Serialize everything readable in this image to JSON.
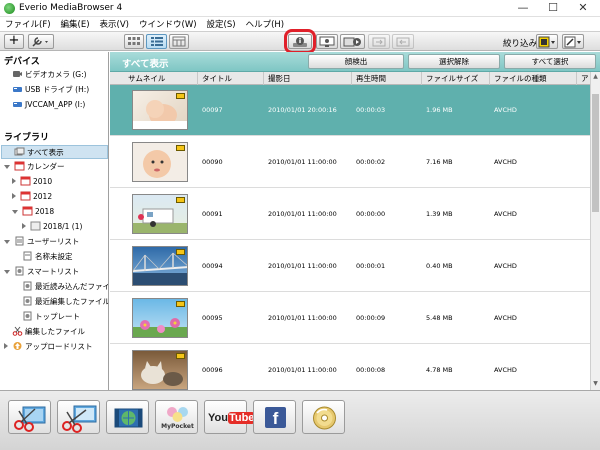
{
  "window": {
    "title": "Everio MediaBrowser 4",
    "minimize": "—",
    "maximize": "☐",
    "close": "✕"
  },
  "menu": [
    "ファイル(F)",
    "編集(E)",
    "表示(V)",
    "ウインドウ(W)",
    "設定(S)",
    "ヘルプ(H)"
  ],
  "toolbar": {
    "add_label": "+",
    "filter_label": "絞り込み"
  },
  "sidebar": {
    "devices_heading": "デバイス",
    "devices": [
      "ビデオカメラ (G:)",
      "USB ドライブ (H:)",
      "JVCCAM_APP (I:)"
    ],
    "library_heading": "ライブラリ",
    "library": [
      "すべて表示",
      "カレンダー",
      "2010",
      "2012",
      "2018",
      "2018/1 (1)",
      "ユーザーリスト",
      "名称未設定",
      "スマートリスト",
      "最近読み込んだファイル",
      "最近編集したファイル",
      "トップレート",
      "編集したファイル",
      "アップロードリスト"
    ]
  },
  "viewbar": {
    "title": "すべて表示",
    "face_detect": "顔検出",
    "deselect": "選択解除",
    "select_all": "すべて選択"
  },
  "columns": [
    "サムネイル",
    "タイトル",
    "撮影日",
    "再生時間",
    "ファイルサイズ",
    "ファイルの種類",
    "ア"
  ],
  "rows": [
    {
      "title": "00097",
      "date": "2010/01/01 20:00:16",
      "duration": "00:00:03",
      "size": "1.96 MB",
      "type": "AVCHD"
    },
    {
      "title": "00090",
      "date": "2010/01/01 11:00:00",
      "duration": "00:00:02",
      "size": "7.16 MB",
      "type": "AVCHD"
    },
    {
      "title": "00091",
      "date": "2010/01/01 11:00:00",
      "duration": "00:00:00",
      "size": "1.39 MB",
      "type": "AVCHD"
    },
    {
      "title": "00094",
      "date": "2010/01/01 11:00:00",
      "duration": "00:00:01",
      "size": "0.40 MB",
      "type": "AVCHD"
    },
    {
      "title": "00095",
      "date": "2010/01/01 11:00:00",
      "duration": "00:00:09",
      "size": "5.48 MB",
      "type": "AVCHD"
    },
    {
      "title": "00096",
      "date": "2010/01/01 11:00:00",
      "duration": "00:00:08",
      "size": "4.78 MB",
      "type": "AVCHD"
    }
  ],
  "bottom": {
    "mypocket": "MyPocket",
    "youtube_you": "You",
    "youtube_tube": "Tube",
    "facebook": "f"
  },
  "colors": {
    "accent_teal": "#7fc6c4",
    "selected_row": "#5fb0ad",
    "highlight_red": "#e0202a"
  }
}
